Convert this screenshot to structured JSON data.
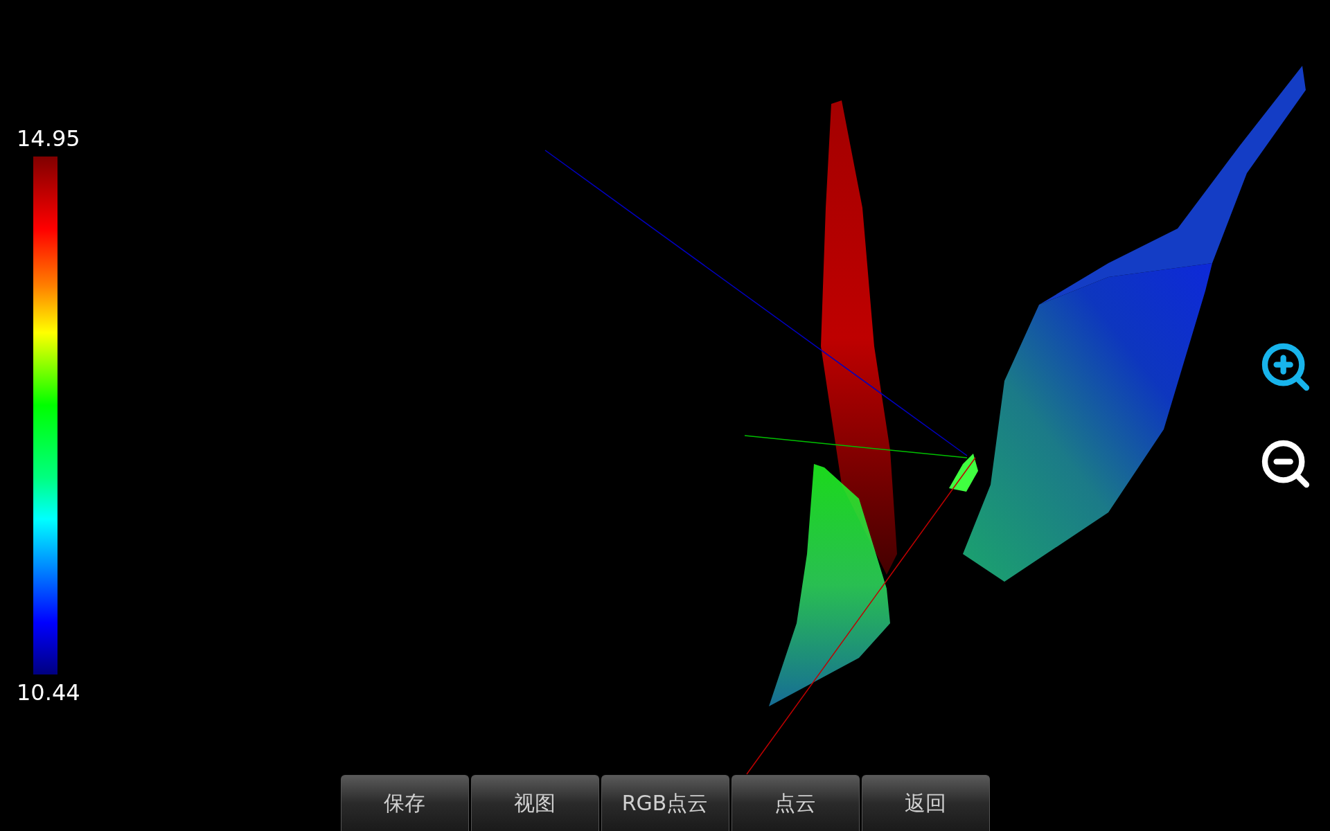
{
  "color_scale": {
    "max": "14.95",
    "min": "10.44"
  },
  "buttons": [
    {
      "label": "保存"
    },
    {
      "label": "视图"
    },
    {
      "label": "RGB点云"
    },
    {
      "label": "点云"
    },
    {
      "label": "返回"
    }
  ]
}
